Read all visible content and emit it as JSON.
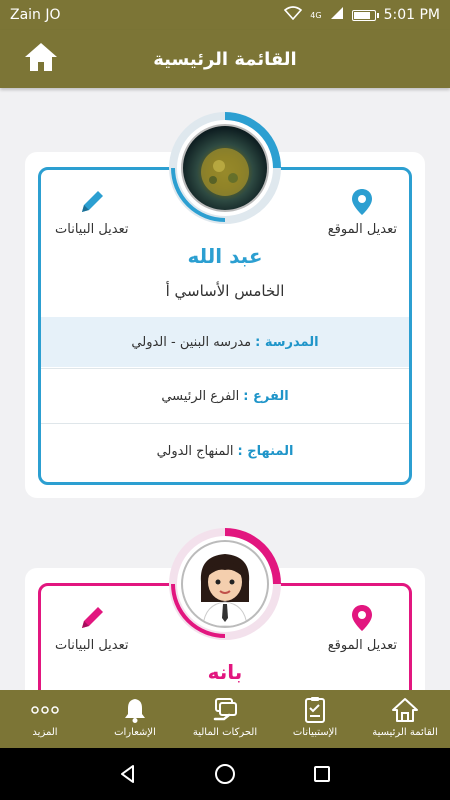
{
  "status": {
    "carrier": "Zain JO",
    "network": "4G",
    "time": "5:01 PM"
  },
  "header": {
    "title": "القائمة الرئيسية"
  },
  "students": [
    {
      "name": "عبد الله",
      "grade": "الخامس الأساسي أ",
      "edit_location": "تعديل الموقع",
      "edit_data": "تعديل البيانات",
      "school_key": "المدرسة :",
      "school_value": "مدرسه البنين - الدولي",
      "branch_key": "الفرع :",
      "branch_value": "الفرع الرئيسي",
      "curriculum_key": "المنهاج :",
      "curriculum_value": "المنهاج الدولي",
      "accent": "#2c9fd1"
    },
    {
      "name": "بانه",
      "edit_location": "تعديل الموقع",
      "edit_data": "تعديل البيانات",
      "accent": "#e2167f"
    }
  ],
  "bottom_nav": [
    {
      "label": "المزيد",
      "icon": "more-icon"
    },
    {
      "label": "الإشعارات",
      "icon": "bell-icon"
    },
    {
      "label": "الحركات المالية",
      "icon": "payments-icon"
    },
    {
      "label": "الإستبيانات",
      "icon": "survey-icon"
    },
    {
      "label": "القائمة الرئيسية",
      "icon": "home-icon"
    }
  ],
  "colors": {
    "brand": "#7c7536",
    "blue_accent": "#2c9fd1",
    "pink_accent": "#e2167f"
  }
}
